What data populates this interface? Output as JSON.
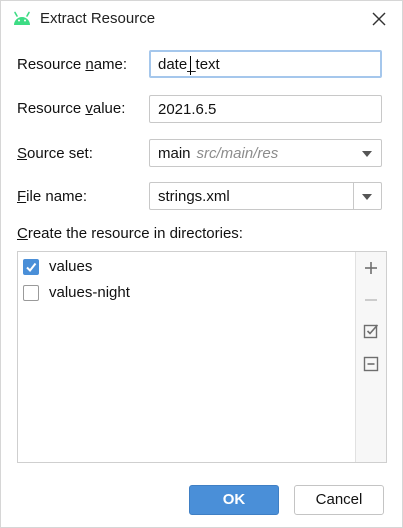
{
  "dialog": {
    "title": "Extract Resource",
    "icon": "android-icon",
    "close_icon": "close-icon"
  },
  "form": {
    "resource_name": {
      "label_pre": "Resource ",
      "label_mn": "n",
      "label_post": "ame:",
      "value": "date_text"
    },
    "resource_value": {
      "label_pre": "Resource ",
      "label_mn": "v",
      "label_post": "alue:",
      "value": "2021.6.5"
    },
    "source_set": {
      "label_mn": "S",
      "label_post": "ource set:",
      "value": "main",
      "hint": "src/main/res"
    },
    "file_name": {
      "label_mn": "F",
      "label_post": "ile name:",
      "value": "strings.xml"
    }
  },
  "directories": {
    "label_mn": "C",
    "label_post": "reate the resource in directories:",
    "items": [
      {
        "label": "values",
        "checked": true
      },
      {
        "label": "values-night",
        "checked": false
      }
    ],
    "toolbar": [
      "add-icon",
      "remove-icon",
      "check-all-icon",
      "uncheck-all-icon"
    ]
  },
  "buttons": {
    "ok": "OK",
    "cancel": "Cancel"
  },
  "colors": {
    "accent": "#4a8fd8",
    "focus_border": "#a5c7ec",
    "android_green": "#3ddc84"
  }
}
